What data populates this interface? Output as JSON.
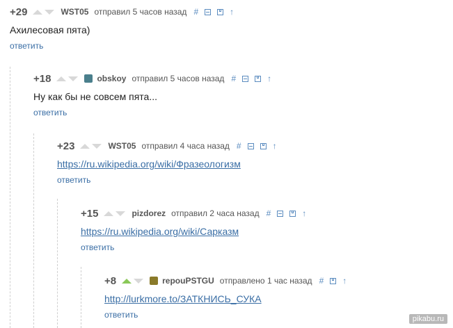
{
  "comments": [
    {
      "rating": "+29",
      "author": "WST05",
      "meta": "отправил 5 часов назад",
      "text": "Ахилесовая пята)",
      "link": "",
      "reply": "ответить",
      "upvoted": false,
      "avatar": false
    },
    {
      "rating": "+18",
      "author": "obskoy",
      "meta": "отправил 5 часов назад",
      "text": "Ну как бы не совсем пята...",
      "link": "",
      "reply": "ответить",
      "upvoted": false,
      "avatar": true,
      "avatar_color": "#4a7f8c"
    },
    {
      "rating": "+23",
      "author": "WST05",
      "meta": "отправил 4 часа назад",
      "text": "",
      "link": "https://ru.wikipedia.org/wiki/Фразеологизм",
      "reply": "ответить",
      "upvoted": false,
      "avatar": false
    },
    {
      "rating": "+15",
      "author": "pizdorez",
      "meta": "отправил 2 часа назад",
      "text": "",
      "link": "https://ru.wikipedia.org/wiki/Сарказм",
      "reply": "ответить",
      "upvoted": false,
      "avatar": false
    },
    {
      "rating": "+8",
      "author": "repouPSTGU",
      "meta": "отправлено 1 час назад",
      "text": "",
      "link": "http://lurkmore.to/ЗАТКНИСЬ_СУКА",
      "reply": "ответить",
      "upvoted": true,
      "avatar": true,
      "avatar_color": "#8a7a2a"
    }
  ],
  "tools": {
    "hash": "#"
  },
  "colors": {
    "link": "#3a6ea5",
    "tool": "#5a8bbf",
    "vote_active": "#8ac858",
    "vote_idle": "#d8d8d8"
  },
  "watermark": "pikabu.ru"
}
